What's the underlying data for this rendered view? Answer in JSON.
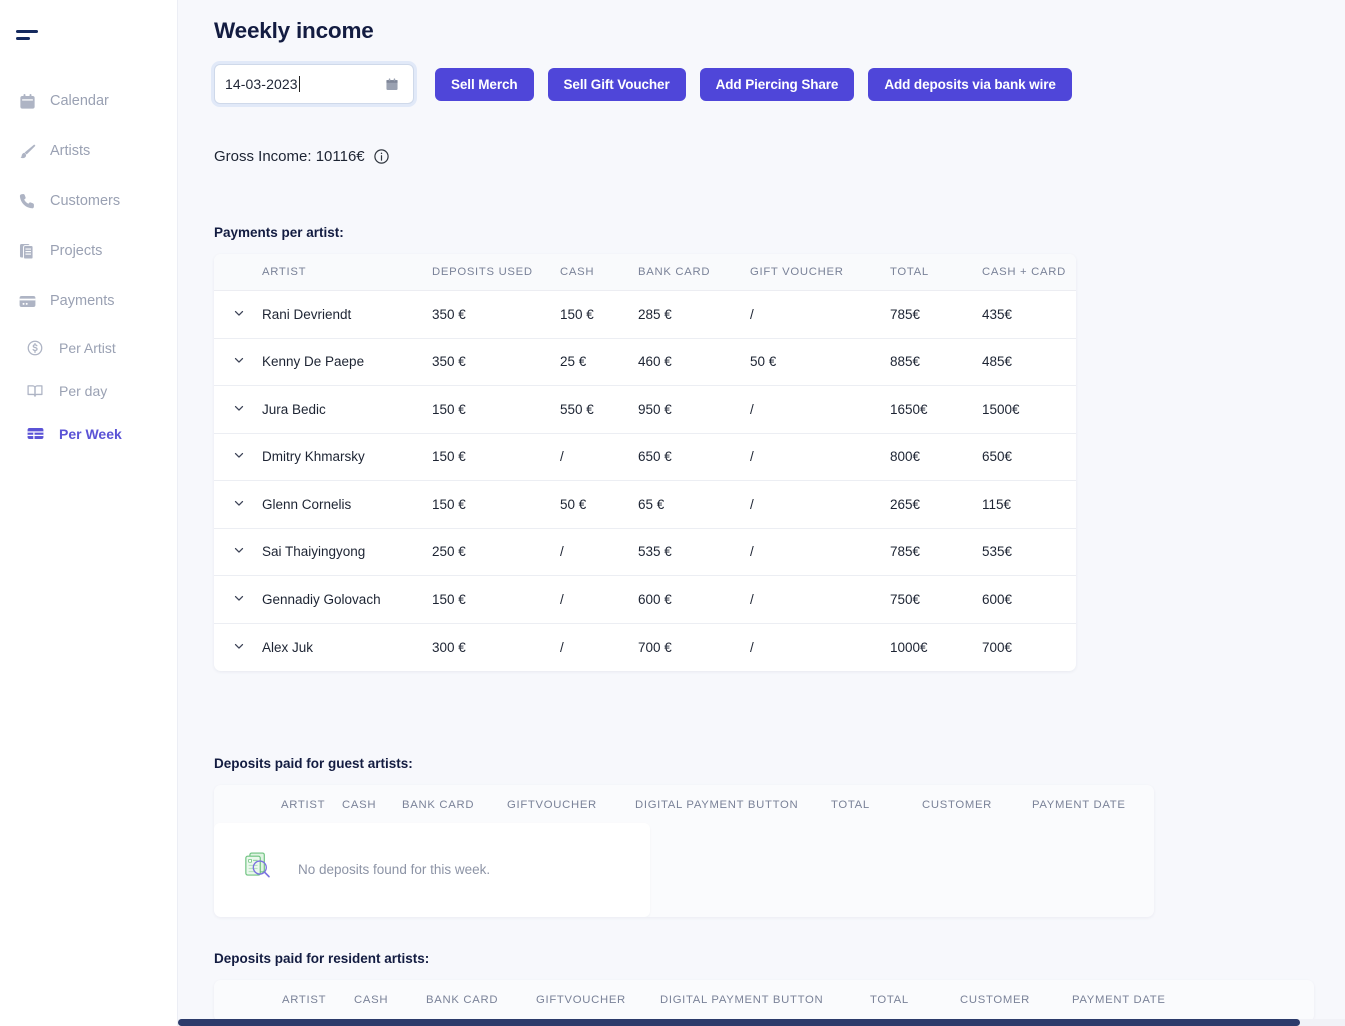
{
  "sidebar": {
    "menu_icon": "hamburger-icon",
    "items": [
      {
        "label": "Calendar",
        "icon": "calendar-icon"
      },
      {
        "label": "Artists",
        "icon": "paintbrush-icon"
      },
      {
        "label": "Customers",
        "icon": "phone-icon"
      },
      {
        "label": "Projects",
        "icon": "documents-icon"
      },
      {
        "label": "Payments",
        "icon": "credit-card-icon"
      }
    ],
    "sub_items": [
      {
        "label": "Per Artist",
        "icon": "dollar-circle-icon",
        "active": false
      },
      {
        "label": "Per day",
        "icon": "book-icon",
        "active": false
      },
      {
        "label": "Per Week",
        "icon": "table-grid-icon",
        "active": true
      }
    ],
    "active_color": "#5b53d6",
    "inactive_color": "#9aa1b3"
  },
  "header": {
    "title": "Weekly income"
  },
  "toolbar": {
    "date_value": "14-03-2023",
    "date_placeholder": "dd-mm-yyyy",
    "calendar_icon": "calendar-icon",
    "buttons": [
      {
        "label": "Sell Merch"
      },
      {
        "label": "Sell Gift Voucher"
      },
      {
        "label": "Add Piercing Share"
      },
      {
        "label": "Add deposits via bank wire"
      }
    ],
    "button_color": "#4f46d9"
  },
  "summary": {
    "gross_income": "Gross Income: 10116€",
    "info_icon": "info-icon"
  },
  "payments_per_artist": {
    "label": "Payments per artist:",
    "columns": [
      "",
      "ARTIST",
      "DEPOSITS USED",
      "CASH",
      "BANK CARD",
      "GIFT VOUCHER",
      "TOTAL",
      "CASH + CARD"
    ],
    "rows": [
      {
        "expand": "chevron-down-icon",
        "artist": "Rani Devriendt",
        "deposits_used": "350 €",
        "cash": "150 €",
        "bank_card": "285 €",
        "gift_voucher": "/",
        "total": "785€",
        "cash_card": "435€"
      },
      {
        "expand": "chevron-down-icon",
        "artist": "Kenny De Paepe",
        "deposits_used": "350 €",
        "cash": "25 €",
        "bank_card": "460 €",
        "gift_voucher": "50 €",
        "total": "885€",
        "cash_card": "485€"
      },
      {
        "expand": "chevron-down-icon",
        "artist": "Jura Bedic",
        "deposits_used": "150 €",
        "cash": "550 €",
        "bank_card": "950 €",
        "gift_voucher": "/",
        "total": "1650€",
        "cash_card": "1500€"
      },
      {
        "expand": "chevron-down-icon",
        "artist": "Dmitry Khmarsky",
        "deposits_used": "150 €",
        "cash": "/",
        "bank_card": "650 €",
        "gift_voucher": "/",
        "total": "800€",
        "cash_card": "650€"
      },
      {
        "expand": "chevron-down-icon",
        "artist": "Glenn Cornelis",
        "deposits_used": "150 €",
        "cash": "50 €",
        "bank_card": "65 €",
        "gift_voucher": "/",
        "total": "265€",
        "cash_card": "115€"
      },
      {
        "expand": "chevron-down-icon",
        "artist": "Sai Thaiyingyong",
        "deposits_used": "250 €",
        "cash": "/",
        "bank_card": "535 €",
        "gift_voucher": "/",
        "total": "785€",
        "cash_card": "535€"
      },
      {
        "expand": "chevron-down-icon",
        "artist": "Gennadiy Golovach",
        "deposits_used": "150 €",
        "cash": "/",
        "bank_card": "600 €",
        "gift_voucher": "/",
        "total": "750€",
        "cash_card": "600€"
      },
      {
        "expand": "chevron-down-icon",
        "artist": "Alex Juk",
        "deposits_used": "300 €",
        "cash": "/",
        "bank_card": "700 €",
        "gift_voucher": "/",
        "total": "1000€",
        "cash_card": "700€"
      }
    ]
  },
  "guest_deposits": {
    "label": "Deposits paid for guest artists:",
    "columns": {
      "artist": "ARTIST",
      "cash": "CASH",
      "bank_card": "BANK CARD",
      "giftvoucher": "GIFTVOUCHER",
      "digital_payment_button": "DIGITAL PAYMENT BUTTON",
      "total": "TOTAL",
      "customer": "CUSTOMER",
      "payment_date": "PAYMENT DATE"
    },
    "empty_message": "No deposits found for this week.",
    "empty_icon": "document-search-icon"
  },
  "resident_deposits": {
    "label": "Deposits paid for resident artists:",
    "columns": {
      "artist": "ARTIST",
      "cash": "CASH",
      "bank_card": "BANK CARD",
      "giftvoucher": "GIFTVOUCHER",
      "digital_payment_button": "DIGITAL PAYMENT BUTTON",
      "total": "TOTAL",
      "customer": "CUSTOMER",
      "payment_date": "PAYMENT DATE"
    }
  }
}
